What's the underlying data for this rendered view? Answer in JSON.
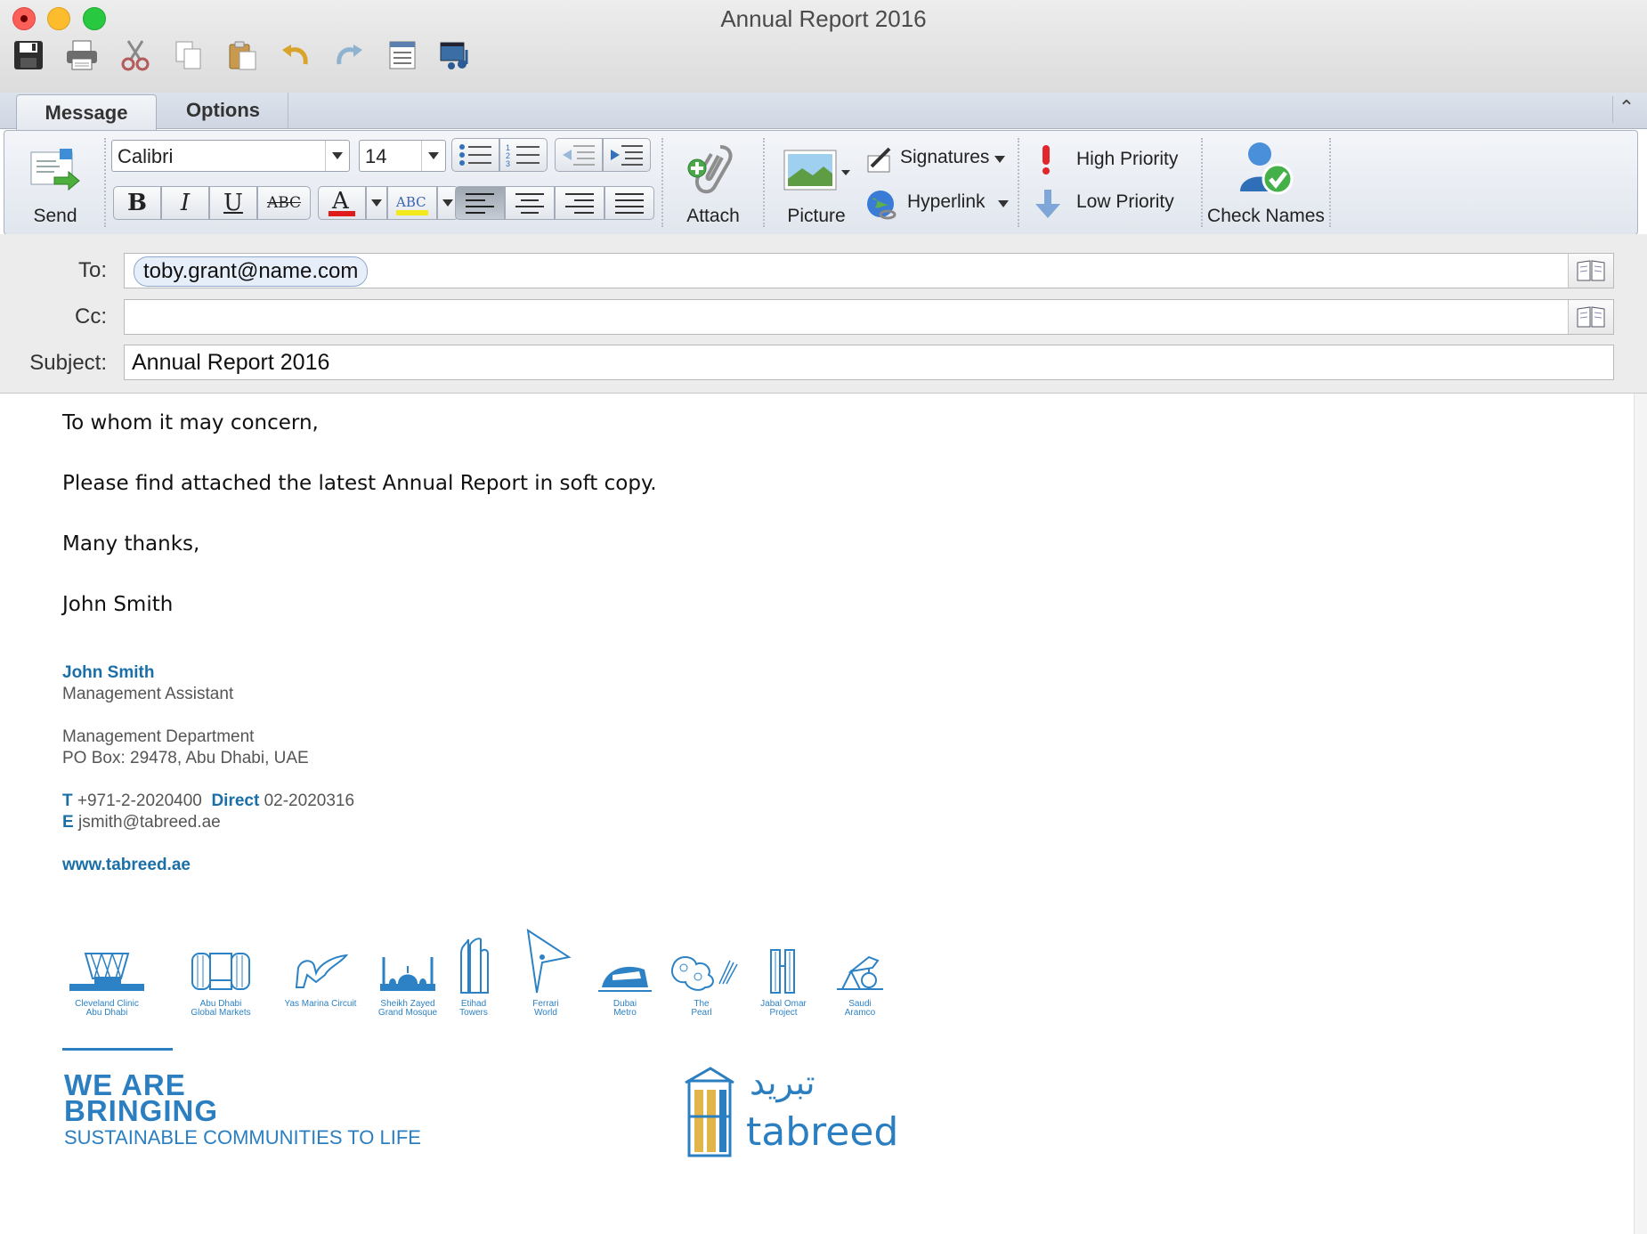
{
  "window": {
    "title": "Annual Report 2016"
  },
  "quick_toolbar": [
    "save-icon",
    "print-icon",
    "cut-icon",
    "copy-icon",
    "paste-icon",
    "undo-icon",
    "redo-icon",
    "format-icon",
    "media-icon"
  ],
  "tabs": {
    "message": "Message",
    "options": "Options"
  },
  "ribbon": {
    "send": "Send",
    "font_name": "Calibri",
    "font_size": "14",
    "attach": "Attach",
    "picture": "Picture",
    "signatures": "Signatures",
    "hyperlink": "Hyperlink",
    "high_priority": "High Priority",
    "low_priority": "Low Priority",
    "check_names": "Check Names"
  },
  "headers": {
    "to_label": "To:",
    "cc_label": "Cc:",
    "subject_label": "Subject:",
    "to_value": "toby.grant@name.com",
    "cc_value": "",
    "subject_value": "Annual Report 2016"
  },
  "body": {
    "greeting": "To whom it may concern,",
    "line1": "Please find attached the latest Annual Report in soft copy.",
    "closing": "Many thanks,",
    "name": "John Smith"
  },
  "signature": {
    "name": "John Smith",
    "title": "Management Assistant",
    "dept": "Management Department",
    "address": "PO Box: 29478, Abu Dhabi, UAE",
    "t_label": "T",
    "t_value": "+971-2-2020400",
    "direct_label": "Direct",
    "direct_value": "02-2020316",
    "e_label": "E",
    "e_value": "jsmith@tabreed.ae",
    "website": "www.tabreed.ae"
  },
  "projects": [
    {
      "l1": "Cleveland Clinic",
      "l2": "Abu Dhabi"
    },
    {
      "l1": "Abu Dhabi",
      "l2": "Global Markets"
    },
    {
      "l1": "Yas Marina Circuit",
      "l2": ""
    },
    {
      "l1": "Sheikh Zayed",
      "l2": "Grand Mosque"
    },
    {
      "l1": "Etihad",
      "l2": "Towers"
    },
    {
      "l1": "Ferrari",
      "l2": "World"
    },
    {
      "l1": "Dubai",
      "l2": "Metro"
    },
    {
      "l1": "The",
      "l2": "Pearl"
    },
    {
      "l1": "Jabal Omar",
      "l2": "Project"
    },
    {
      "l1": "Saudi",
      "l2": "Aramco"
    }
  ],
  "banner": {
    "slogan_line1": "WE ARE",
    "slogan_line2": "BRINGING",
    "slogan_line3": "SUSTAINABLE COMMUNITIES TO LIFE",
    "logo_arabic": "تبريد",
    "logo_latin": "tabreed"
  },
  "colors": {
    "brand_blue": "#2b7fc1",
    "signature_blue": "#1a6fa8"
  }
}
